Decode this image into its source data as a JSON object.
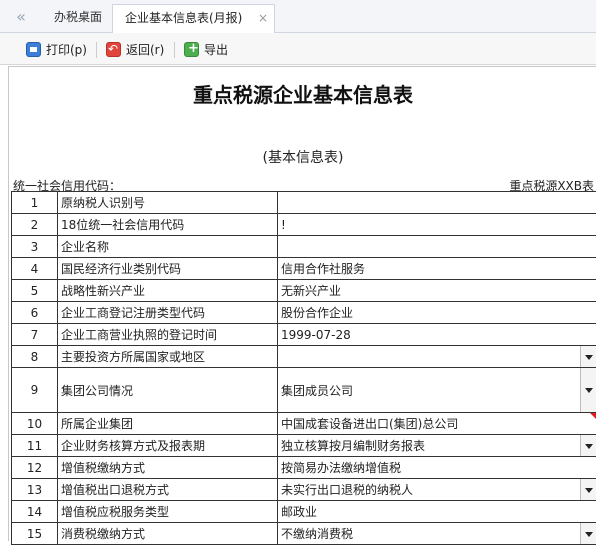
{
  "tabs": {
    "home": "办税桌面",
    "active": "企业基本信息表(月报)",
    "close": "×"
  },
  "toolbar": {
    "print": "打印(p)",
    "back": "返回(r)",
    "export": "导出"
  },
  "form": {
    "title": "重点税源企业基本信息表",
    "subtitle": "(基本信息表)",
    "credit_label": "统一社会信用代码：",
    "table_code": "重点税源XXB表"
  },
  "rows": [
    {
      "no": "1",
      "label": "原纳税人识别号",
      "value": "",
      "dropdown": false
    },
    {
      "no": "2",
      "label": "18位统一社会信用代码",
      "value": "!",
      "dropdown": false
    },
    {
      "no": "3",
      "label": "企业名称",
      "value": "",
      "dropdown": false
    },
    {
      "no": "4",
      "label": "国民经济行业类别代码",
      "value": "信用合作社服务",
      "dropdown": false
    },
    {
      "no": "5",
      "label": "战略性新兴产业",
      "value": "无新兴产业",
      "dropdown": false
    },
    {
      "no": "6",
      "label": "企业工商登记注册类型代码",
      "value": "股份合作企业",
      "dropdown": false
    },
    {
      "no": "7",
      "label": "企业工商营业执照的登记时间",
      "value": "1999-07-28",
      "dropdown": false
    },
    {
      "no": "8",
      "label": "主要投资方所属国家或地区",
      "value": "",
      "dropdown": true
    },
    {
      "no": "9",
      "label": "集团公司情况",
      "value": "集团成员公司",
      "dropdown": true
    },
    {
      "no": "10",
      "label": "所属企业集团",
      "value": "中国成套设备进出口(集团)总公司",
      "dropdown": false
    },
    {
      "no": "11",
      "label": "企业财务核算方式及报表期",
      "value": "独立核算按月编制财务报表",
      "dropdown": true
    },
    {
      "no": "12",
      "label": "增值税缴纳方式",
      "value": "按简易办法缴纳增值税",
      "dropdown": false
    },
    {
      "no": "13",
      "label": "增值税出口退税方式",
      "value": "未实行出口退税的纳税人",
      "dropdown": true
    },
    {
      "no": "14",
      "label": "增值税应税服务类型",
      "value": "邮政业",
      "dropdown": false
    },
    {
      "no": "15",
      "label": "消费税缴纳方式",
      "value": "不缴纳消费税",
      "dropdown": true
    }
  ]
}
